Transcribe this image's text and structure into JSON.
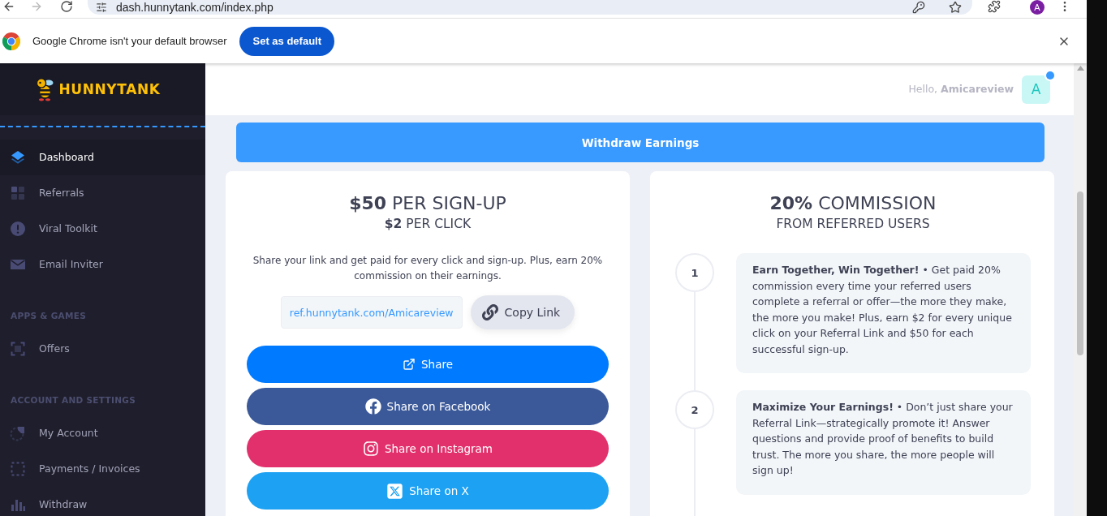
{
  "browser": {
    "address": "dash.hunnytank.com/index.php",
    "profile_initial": "A",
    "forward_disabled": true
  },
  "infobar": {
    "message": "Google Chrome isn't your default browser",
    "button": "Set as default"
  },
  "sidebar": {
    "logo": "HUNNYTANK",
    "groups": [
      {
        "items": [
          {
            "label": "Dashboard",
            "selected": true
          },
          {
            "label": "Referrals",
            "selected": false
          },
          {
            "label": "Viral Toolkit",
            "selected": false
          },
          {
            "label": "Email Inviter",
            "selected": false
          }
        ]
      },
      {
        "heading": "APPS & GAMES",
        "items": [
          {
            "label": "Offers",
            "selected": false
          }
        ]
      },
      {
        "heading": "ACCOUNT AND SETTINGS",
        "items": [
          {
            "label": "My Account",
            "selected": false
          },
          {
            "label": "Payments / Invoices",
            "selected": false
          },
          {
            "label": "Withdraw",
            "selected": false
          }
        ]
      }
    ]
  },
  "header": {
    "greeting": "Hello, **Amicareview**",
    "avatar": "A",
    "notification": true
  },
  "withdraw_button": "Withdraw Earnings",
  "referral_card": {
    "headline": "**$50** PER SIGN-UP",
    "subheadline": "**$2** PER CLICK",
    "description": "Share your link and get paid for every click and sign-up. Plus, earn 20% commission on their earnings.",
    "link": "ref.hunnytank.com/Amicareview",
    "copy_button": "Copy Link",
    "share_buttons": [
      {
        "kind": "share",
        "label": "Share",
        "color": "#007bff"
      },
      {
        "kind": "facebook",
        "label": "Share on Facebook",
        "color": "#3b5998"
      },
      {
        "kind": "instagram",
        "label": "Share on Instagram",
        "color": "#e1306c"
      },
      {
        "kind": "x",
        "label": "Share on X",
        "color": "#1da1f2"
      }
    ]
  },
  "commission_card": {
    "headline": "**20%** COMMISSION",
    "subheadline": "FROM REFERRED USERS",
    "steps": [
      {
        "number": "1",
        "text": "**Earn Together, Win Together!** • Get paid 20% commission every time your referred users complete a referral or offer—the more they make, the more you make! Plus, earn $2 for every unique click on your Referral Link and $50 for each successful sign-up."
      },
      {
        "number": "2",
        "text": "**Maximize Your Earnings!** • Don’t just share your Referral Link—strategically promote it! Answer questions and provide proof of benefits to build trust. The more you share, the more people will sign up!"
      }
    ]
  }
}
